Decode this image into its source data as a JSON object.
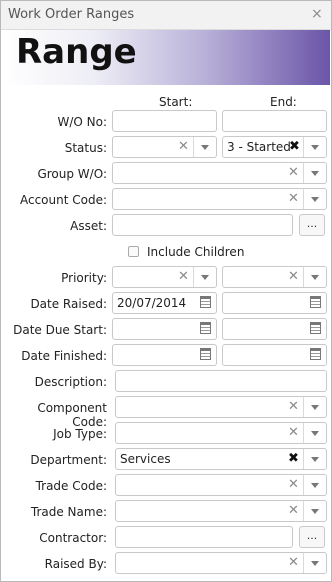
{
  "window": {
    "title": "Work Order Ranges",
    "close_glyph": "×"
  },
  "banner": {
    "heading": "Range"
  },
  "columns": {
    "start": "Start:",
    "end": "End:"
  },
  "labels": {
    "wo_no": "W/O No:",
    "status": "Status:",
    "group_wo": "Group W/O:",
    "account_code": "Account Code:",
    "asset": "Asset:",
    "priority": "Priority:",
    "date_raised": "Date Raised:",
    "date_due_start": "Date Due Start:",
    "date_finished": "Date Finished:",
    "description": "Description:",
    "component_code": "Component Code:",
    "job_type": "Job Type:",
    "department": "Department:",
    "trade_code": "Trade Code:",
    "trade_name": "Trade Name:",
    "contractor": "Contractor:",
    "raised_by": "Raised By:"
  },
  "values": {
    "wo_no_start": "",
    "wo_no_end": "",
    "status_start": "",
    "status_end": "3 - Started",
    "group_wo": "",
    "account_code": "",
    "asset": "",
    "priority_start": "",
    "priority_end": "",
    "date_raised_start": "20/07/2014",
    "date_raised_end": "",
    "date_due_start_start": "",
    "date_due_start_end": "",
    "date_finished_start": "",
    "date_finished_end": "",
    "description": "",
    "component_code": "",
    "job_type": "",
    "department": "Services",
    "trade_code": "",
    "trade_name": "",
    "contractor": "",
    "raised_by": ""
  },
  "include_children": {
    "label": "Include Children",
    "checked": false
  },
  "browse_button": "...",
  "clear_glyph": "✕",
  "clear_glyph_bold": "✖"
}
